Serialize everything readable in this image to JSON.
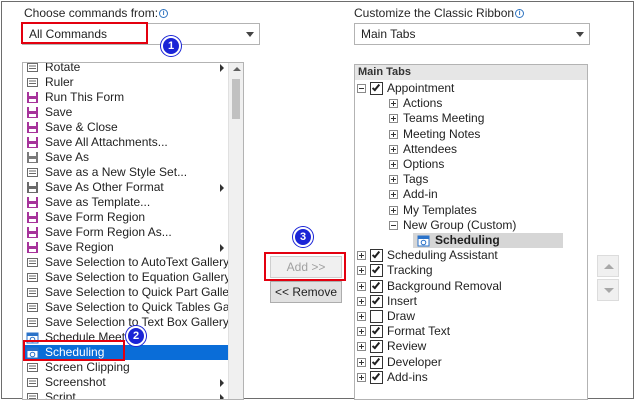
{
  "left_panel": {
    "label": "Choose commands from:",
    "combo_value": "All Commands",
    "commands": [
      {
        "label": "Rotate",
        "icon": "rotate-icon",
        "submenu": true
      },
      {
        "label": "Ruler",
        "icon": "ruler-icon",
        "submenu": false
      },
      {
        "label": "Run This Form",
        "icon": "run-form-icon",
        "submenu": false
      },
      {
        "label": "Save",
        "icon": "save-icon",
        "submenu": false
      },
      {
        "label": "Save & Close",
        "icon": "save-close-icon",
        "submenu": false
      },
      {
        "label": "Save All Attachments...",
        "icon": "save-attachments-icon",
        "submenu": false
      },
      {
        "label": "Save As",
        "icon": "save-as-icon",
        "submenu": false
      },
      {
        "label": "Save as a New Style Set...",
        "icon": "style-set-icon",
        "submenu": false
      },
      {
        "label": "Save As Other Format",
        "icon": "save-other-format-icon",
        "submenu": true
      },
      {
        "label": "Save as Template...",
        "icon": "template-icon",
        "submenu": false
      },
      {
        "label": "Save Form Region",
        "icon": "save-form-region-icon",
        "submenu": false
      },
      {
        "label": "Save Form Region As...",
        "icon": "save-form-region-as-icon",
        "submenu": false
      },
      {
        "label": "Save Region",
        "icon": "save-region-icon",
        "submenu": true
      },
      {
        "label": "Save Selection to AutoText Gallery",
        "icon": "autotext-icon",
        "submenu": false
      },
      {
        "label": "Save Selection to Equation Gallery...",
        "icon": "equation-icon",
        "submenu": false
      },
      {
        "label": "Save Selection to Quick Part Galler...",
        "icon": "quick-part-icon",
        "submenu": false
      },
      {
        "label": "Save Selection to Quick Tables Gall...",
        "icon": "quick-tables-icon",
        "submenu": false
      },
      {
        "label": "Save Selection to Text Box Gallery",
        "icon": "text-box-icon",
        "submenu": false
      },
      {
        "label": "Schedule Meeti",
        "icon": "schedule-meeting-icon",
        "submenu": false
      },
      {
        "label": "Scheduling",
        "icon": "scheduling-icon",
        "submenu": false,
        "selected": true
      },
      {
        "label": "Screen Clipping",
        "icon": "screen-clipping-icon",
        "submenu": false
      },
      {
        "label": "Screenshot",
        "icon": "screenshot-icon",
        "submenu": true
      },
      {
        "label": "Script",
        "icon": "script-icon",
        "submenu": true
      }
    ]
  },
  "middle": {
    "add_label": "Add >>",
    "remove_label": "<< Remove"
  },
  "right_panel": {
    "label": "Customize the Classic Ribbon",
    "combo_value": "Main Tabs",
    "tree_header": "Main Tabs",
    "tree": [
      {
        "label": "Appointment",
        "level": 0,
        "expander": "minus",
        "checkbox": "checked"
      },
      {
        "label": "Actions",
        "level": 1,
        "expander": "plus",
        "checkbox": "none"
      },
      {
        "label": "Teams Meeting",
        "level": 1,
        "expander": "plus",
        "checkbox": "none"
      },
      {
        "label": "Meeting Notes",
        "level": 1,
        "expander": "plus",
        "checkbox": "none"
      },
      {
        "label": "Attendees",
        "level": 1,
        "expander": "plus",
        "checkbox": "none"
      },
      {
        "label": "Options",
        "level": 1,
        "expander": "plus",
        "checkbox": "none"
      },
      {
        "label": "Tags",
        "level": 1,
        "expander": "plus",
        "checkbox": "none"
      },
      {
        "label": "Add-in",
        "level": 1,
        "expander": "plus",
        "checkbox": "none"
      },
      {
        "label": "My Templates",
        "level": 1,
        "expander": "plus",
        "checkbox": "none"
      },
      {
        "label": "New Group (Custom)",
        "level": 1,
        "expander": "minus",
        "checkbox": "none"
      },
      {
        "label": "Scheduling",
        "level": 2,
        "expander": "none",
        "checkbox": "none",
        "icon": "scheduling-icon",
        "highlight": true
      },
      {
        "label": "Scheduling Assistant",
        "level": 0,
        "expander": "plus",
        "checkbox": "checked"
      },
      {
        "label": "Tracking",
        "level": 0,
        "expander": "plus",
        "checkbox": "checked"
      },
      {
        "label": "Background Removal",
        "level": 0,
        "expander": "plus",
        "checkbox": "checked"
      },
      {
        "label": "Insert",
        "level": 0,
        "expander": "plus",
        "checkbox": "checked"
      },
      {
        "label": "Draw",
        "level": 0,
        "expander": "plus",
        "checkbox": "unchecked"
      },
      {
        "label": "Format Text",
        "level": 0,
        "expander": "plus",
        "checkbox": "checked"
      },
      {
        "label": "Review",
        "level": 0,
        "expander": "plus",
        "checkbox": "checked"
      },
      {
        "label": "Developer",
        "level": 0,
        "expander": "plus",
        "checkbox": "checked"
      },
      {
        "label": "Add-ins",
        "level": 0,
        "expander": "plus",
        "checkbox": "checked"
      }
    ]
  },
  "callouts": [
    "1",
    "2",
    "3"
  ],
  "colors": {
    "highlight_box": "#e3000f",
    "badge": "#1a24d6",
    "selection": "#0a6dd8"
  }
}
